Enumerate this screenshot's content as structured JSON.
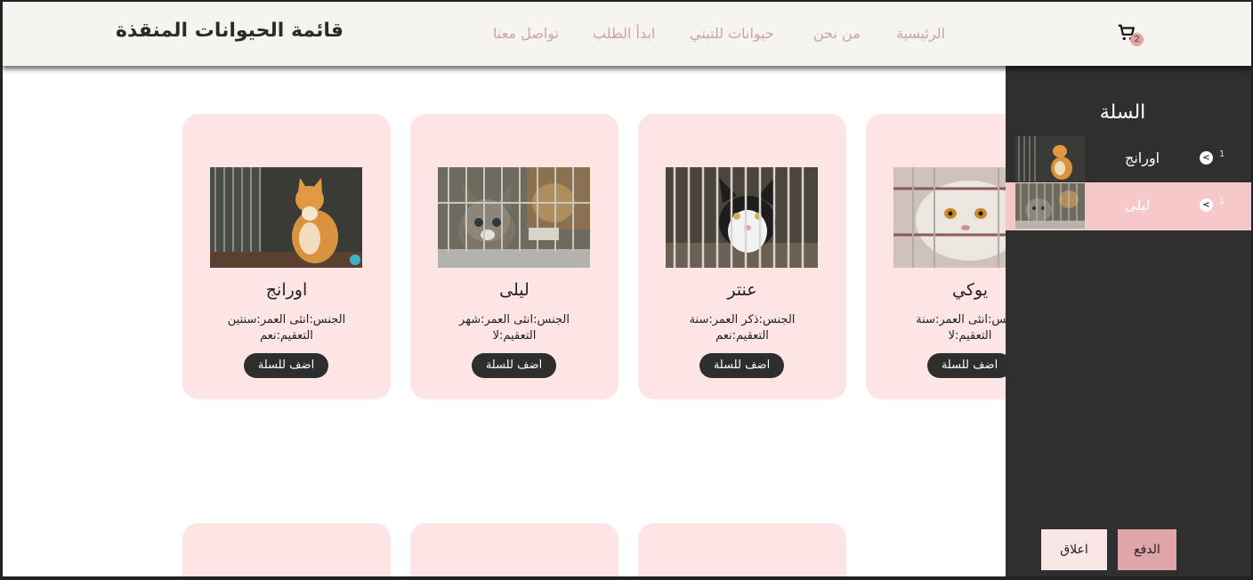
{
  "header": {
    "title": "قائمة الحيوانات المنقذة",
    "nav": [
      "تواصل معنا",
      "ابدأ الطلب",
      "حيوانات للتبني",
      "من نحن",
      "الرئيسية"
    ],
    "cart_count": "2"
  },
  "animals": [
    {
      "name": "اورانج",
      "line1": "الجنس:انثى العمر:سنتين",
      "line2": "التعقيم:نعم",
      "button": "اضف للسلة"
    },
    {
      "name": "ليلى",
      "line1": "الجنس:انثى العمر:شهر",
      "line2": "التعقيم:لا",
      "button": "اضف للسلة"
    },
    {
      "name": "عنتر",
      "line1": "الجنس:ذكر العمر:سنة",
      "line2": "التعقيم:نعم",
      "button": "اضف للسلة"
    },
    {
      "name": "يوكي",
      "line1": "الجنس:انثى العمر:سنة",
      "line2": "التعقيم:لا",
      "button": "اضف للسلة"
    }
  ],
  "cart": {
    "title": "السلة",
    "items": [
      {
        "name": "اورانج",
        "qty": "1",
        "remove": "<"
      },
      {
        "name": "ليلى",
        "qty": "1",
        "remove": "<"
      }
    ],
    "pay_label": "الدفع",
    "close_label": "اعلاق"
  },
  "colors": {
    "header_bg": "#f5f4ef",
    "card_bg": "#fde5e5",
    "panel_bg": "#2f2f2f",
    "accent": "#dfa5a8",
    "nav_text": "#cfa3a0"
  }
}
